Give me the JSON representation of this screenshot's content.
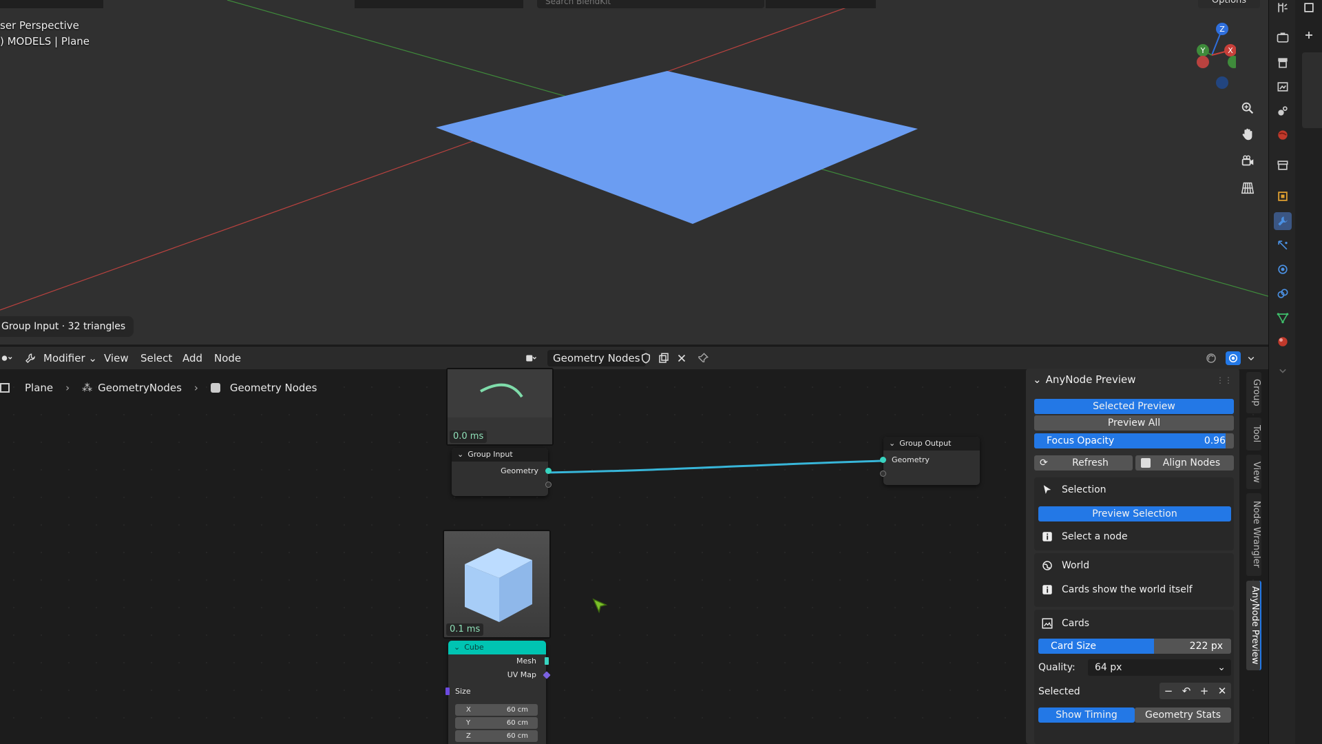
{
  "viewport": {
    "view_name": "ser Perspective",
    "collection_line": ") MODELS | Plane",
    "search_placeholder": "Search BlendKit",
    "options_label": "Options",
    "status_pill": "Group Input · 32 triangles",
    "plane_color": "#6b9df2",
    "grid_color": "#3a3a3a",
    "x_axis_color": "#b9423f",
    "y_axis_color": "#3f8b3b",
    "gizmo": {
      "z_label": "Z",
      "y_label": "Y",
      "x_label": "X"
    }
  },
  "node_editor": {
    "header": {
      "editor_menu": "Modifier",
      "menus": [
        "View",
        "Select",
        "Add",
        "Node"
      ],
      "tree_name": "Geometry Nodes"
    },
    "breadcrumb": [
      "Plane",
      "GeometryNodes",
      "Geometry Nodes"
    ],
    "nodes": {
      "group_input": {
        "title": "Group Input",
        "socket": "Geometry",
        "timing": "0.0 ms"
      },
      "group_output": {
        "title": "Group Output",
        "socket": "Geometry"
      },
      "cube": {
        "title": "Cube",
        "timing": "0.1 ms",
        "outputs": [
          "Mesh",
          "UV Map"
        ],
        "size_label": "Size",
        "size": [
          {
            "axis": "X",
            "value": "60 cm"
          },
          {
            "axis": "Y",
            "value": "60 cm"
          },
          {
            "axis": "Z",
            "value": "60 cm"
          }
        ]
      }
    },
    "link_color": "#38b6d9"
  },
  "sidebar": {
    "title": "AnyNode Preview",
    "selected_preview": "Selected Preview",
    "preview_all": "Preview All",
    "focus_opacity": {
      "label": "Focus Opacity",
      "value": "0.96",
      "fraction": 0.96
    },
    "refresh": "Refresh",
    "align_nodes": "Align Nodes",
    "selection": {
      "heading": "Selection",
      "button": "Preview Selection",
      "hint": "Select a node"
    },
    "world": {
      "heading": "World",
      "hint": "Cards show the world itself"
    },
    "cards": {
      "heading": "Cards",
      "card_size": {
        "label": "Card Size",
        "value": "222 px",
        "fraction": 0.6
      },
      "quality_label": "Quality:",
      "quality_value": "64 px",
      "selected_label": "Selected",
      "show_timing": "Show Timing",
      "geometry_stats": "Geometry Stats"
    },
    "tabs": [
      "Group",
      "Tool",
      "View",
      "Node Wrangler",
      "AnyNode Preview"
    ],
    "accent": "#2378e6"
  }
}
